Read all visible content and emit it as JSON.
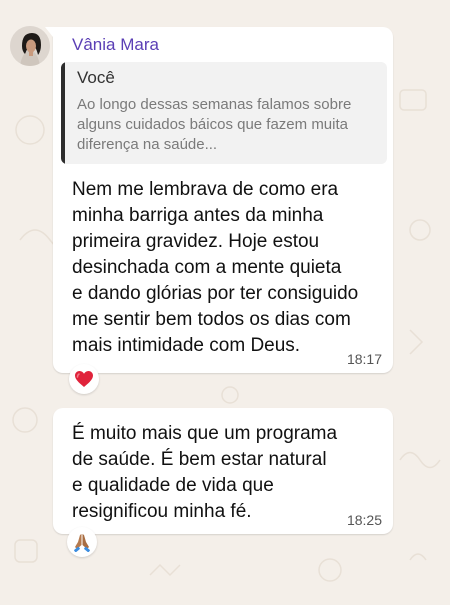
{
  "chat": {
    "messages": [
      {
        "sender": "Vânia Mara",
        "quote": {
          "author": "Você",
          "text": "Ao longo dessas semanas falamos sobre alguns cuidados báicos que fazem muita diferença na saúde..."
        },
        "text": "Nem me lembrava de como era\nminha barriga antes da minha\nprimeira gravidez. Hoje estou\ndesinchada com a mente quieta\ne dando glórias por ter consiguido\nme sentir bem todos os dias com\nmais intimidade com Deus.",
        "time": "18:17",
        "reaction": "heart-icon"
      },
      {
        "text": " É muito mais que um programa\nde saúde. É bem estar natural\ne qualidade de vida que\nresignificou minha fé.",
        "time": "18:25",
        "reaction": "praying-hands-icon"
      }
    ]
  },
  "colors": {
    "background": "#f4efe9",
    "bubble": "#ffffff",
    "sender_name": "#5b3fb5",
    "quote_bar": "#2d2d2d",
    "heart": "#e0233b"
  }
}
